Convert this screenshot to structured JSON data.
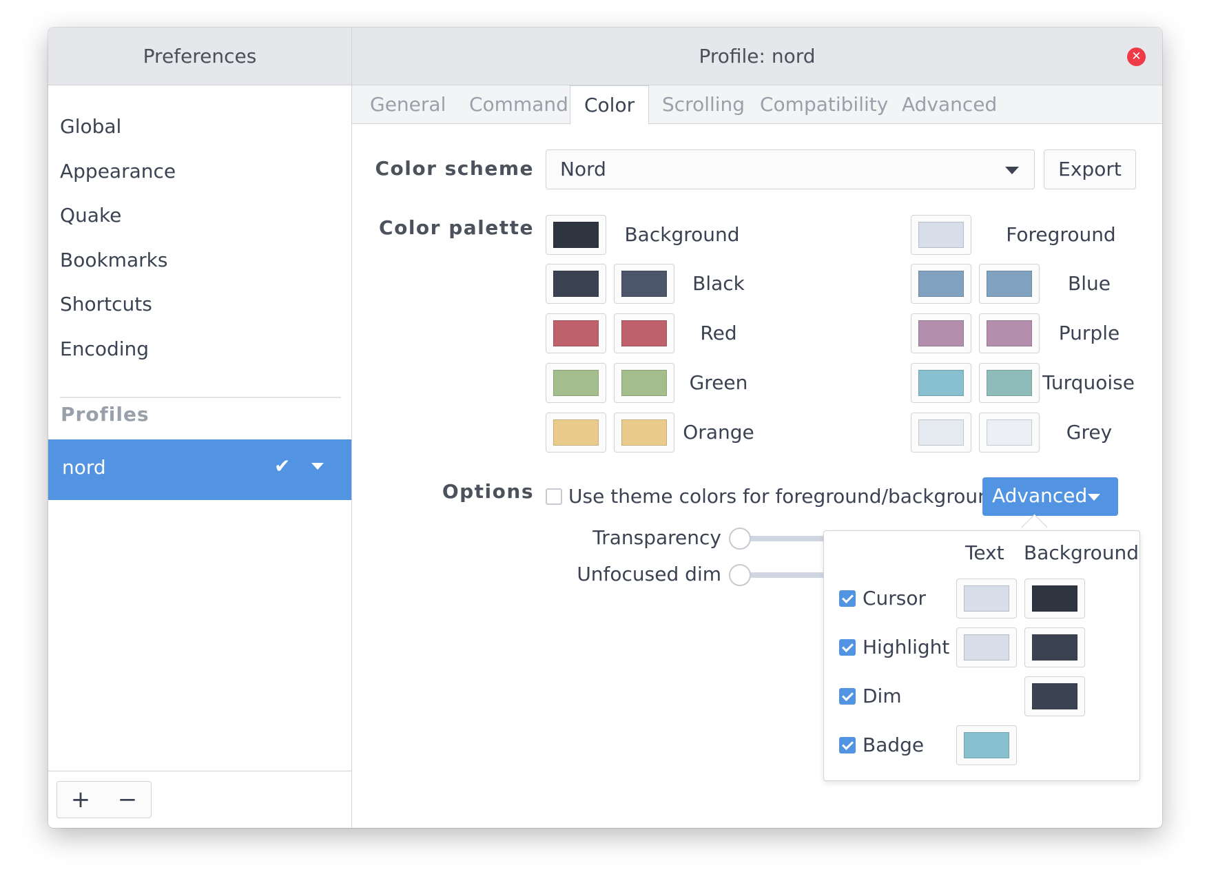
{
  "window": {
    "left_title": "Preferences",
    "right_title": "Profile: nord",
    "close_icon": "close-icon"
  },
  "sidebar": {
    "items": [
      {
        "label": "Global"
      },
      {
        "label": "Appearance"
      },
      {
        "label": "Quake"
      },
      {
        "label": "Bookmarks"
      },
      {
        "label": "Shortcuts"
      },
      {
        "label": "Encoding"
      }
    ],
    "section_label": "Profiles",
    "profile": {
      "name": "nord",
      "selected": true
    },
    "add_label": "+",
    "remove_label": "−"
  },
  "tabs": [
    {
      "label": "General"
    },
    {
      "label": "Command"
    },
    {
      "label": "Color",
      "active": true
    },
    {
      "label": "Scrolling"
    },
    {
      "label": "Compatibility"
    },
    {
      "label": "Advanced"
    }
  ],
  "color_scheme": {
    "label": "Color scheme",
    "value": "Nord",
    "export_label": "Export"
  },
  "palette": {
    "label": "Color palette",
    "background": {
      "label": "Background",
      "color": "#2e3440"
    },
    "foreground": {
      "label": "Foreground",
      "color": "#d8dee9"
    },
    "black": {
      "label": "Black",
      "normal": "#3b4252",
      "bright": "#4c566a"
    },
    "red": {
      "label": "Red",
      "normal": "#bf616a",
      "bright": "#bf616a"
    },
    "green": {
      "label": "Green",
      "normal": "#a3be8c",
      "bright": "#a3be8c"
    },
    "orange": {
      "label": "Orange",
      "normal": "#ebcb8b",
      "bright": "#ebcb8b"
    },
    "blue": {
      "label": "Blue",
      "normal": "#81a1c1",
      "bright": "#81a1c1"
    },
    "purple": {
      "label": "Purple",
      "normal": "#b48ead",
      "bright": "#b48ead"
    },
    "turquoise": {
      "label": "Turquoise",
      "normal": "#88c0d0",
      "bright": "#8fbcbb"
    },
    "grey": {
      "label": "Grey",
      "normal": "#e5e9f0",
      "bright": "#eceff4"
    }
  },
  "options": {
    "label": "Options",
    "theme_colors_label": "Use theme colors for foreground/background",
    "theme_colors_checked": false,
    "advanced_label": "Advanced",
    "transparency_label": "Transparency",
    "transparency_value": 0,
    "unfocused_dim_label": "Unfocused dim",
    "unfocused_dim_value": 0
  },
  "advanced_popover": {
    "text_header": "Text",
    "background_header": "Background",
    "rows": [
      {
        "label": "Cursor",
        "checked": true,
        "text_color": "#d8dee9",
        "bg_color": "#2e3440"
      },
      {
        "label": "Highlight",
        "checked": true,
        "text_color": "#d8dee9",
        "bg_color": "#3b4252"
      },
      {
        "label": "Dim",
        "checked": true,
        "bg_color": "#3b4252"
      },
      {
        "label": "Badge",
        "checked": true,
        "text_color": "#88c0d0"
      }
    ]
  },
  "colors": {
    "accent": "#5294e2",
    "close": "#ef3a47"
  }
}
